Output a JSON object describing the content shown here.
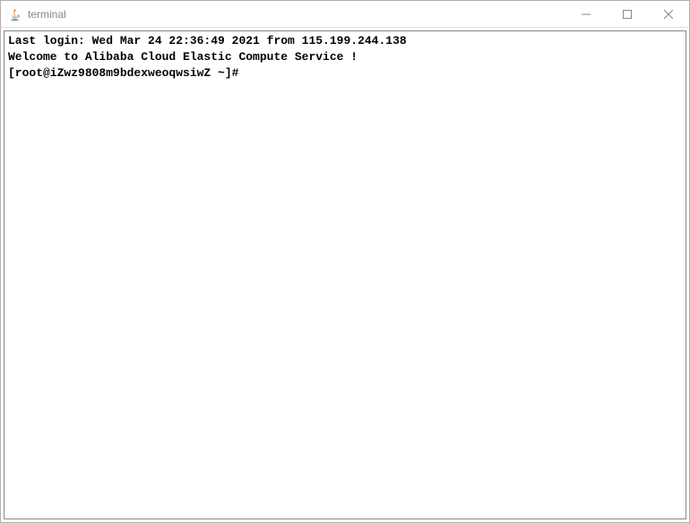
{
  "window": {
    "title": "terminal"
  },
  "terminal": {
    "line1": "Last login: Wed Mar 24 22:36:49 2021 from 115.199.244.138",
    "line2": "",
    "line3": "Welcome to Alibaba Cloud Elastic Compute Service !",
    "line4": "",
    "prompt": "[root@iZwz9808m9bdexweoqwsiwZ ~]# "
  }
}
